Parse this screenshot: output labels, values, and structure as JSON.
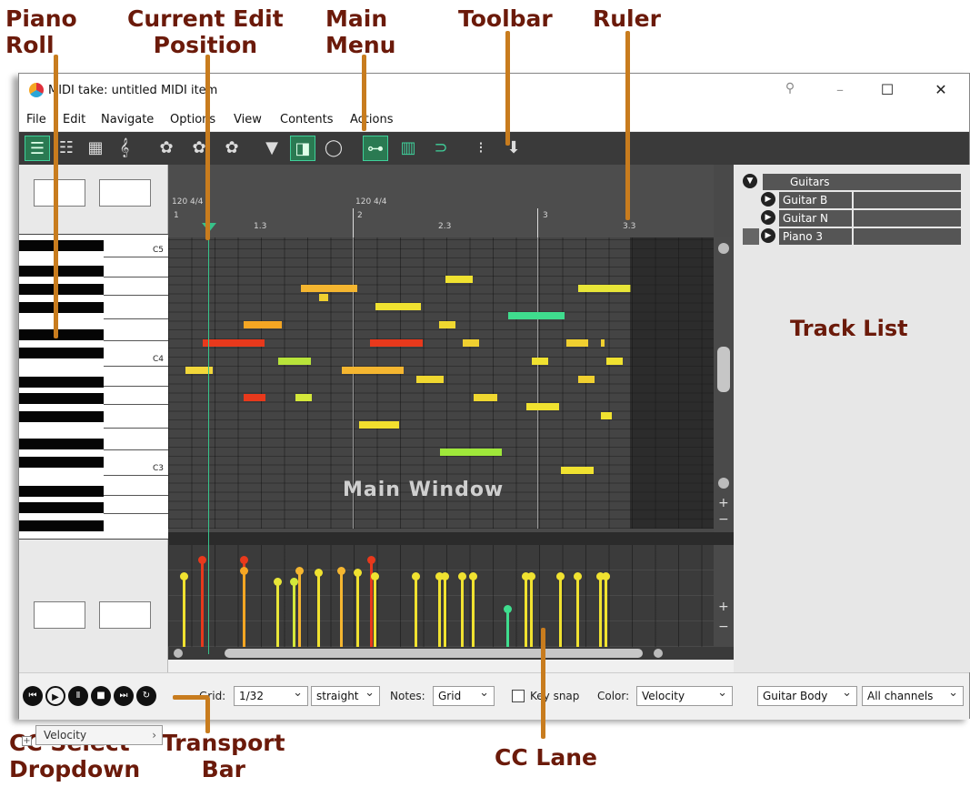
{
  "callouts": {
    "piano_roll": "Piano\nRoll",
    "edit_position": "Current Edit\nPosition",
    "main_menu": "Main\nMenu",
    "toolbar": "Toolbar",
    "ruler": "Ruler",
    "track_list": "Track List",
    "main_window": "Main Window",
    "cc_select": "CC Select\nDropdown",
    "transport": "Transport\nBar",
    "cc_lane": "CC Lane"
  },
  "window": {
    "title": "MIDI take: untitled MIDI item"
  },
  "menu": [
    "File",
    "Edit",
    "Navigate",
    "Options",
    "View",
    "Contents",
    "Actions"
  ],
  "ruler": {
    "tempo1": "120 4/4",
    "tempo2": "120 4/4",
    "marks": [
      "1",
      "1.3",
      "2",
      "2.3",
      "3",
      "3.3"
    ]
  },
  "piano": {
    "c5": "C5",
    "c4": "C4",
    "c3": "C3"
  },
  "cc_select": "Velocity",
  "tracks": [
    {
      "name": "Guitars"
    },
    {
      "name": "Guitar B"
    },
    {
      "name": "Guitar N"
    },
    {
      "name": "Piano 3"
    }
  ],
  "bottom": {
    "grid_label": "Grid:",
    "grid_value": "1/32",
    "swing_value": "straight",
    "notes_label": "Notes:",
    "notes_value": "Grid",
    "keysnap_label": "Key snap",
    "color_label": "Color:",
    "color_value": "Velocity",
    "channel_track": "Guitar Body",
    "channels": "All channels"
  },
  "colors": {
    "red": "#e8391c",
    "orange": "#f5a623",
    "yellow": "#e8e638",
    "green": "#3fdd8e"
  }
}
